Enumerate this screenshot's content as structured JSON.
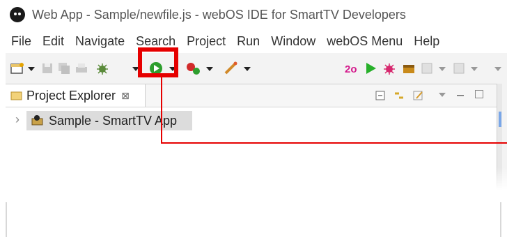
{
  "window": {
    "title": "Web App - Sample/newfile.js - webOS IDE for SmartTV Developers"
  },
  "menu": [
    "File",
    "Edit",
    "Navigate",
    "Search",
    "Project",
    "Run",
    "Window",
    "webOS Menu",
    "Help"
  ],
  "toolbar": {
    "icons": [
      "new-wizard-icon",
      "save-icon",
      "save-all-icon",
      "print-icon",
      "debug-icon",
      "run-icon",
      "external-tools-icon",
      "launch-icon",
      "webos-project-icon",
      "run-green-icon",
      "debug-bug-icon",
      "package-icon",
      "history-icon",
      "nav-icon"
    ]
  },
  "explorer": {
    "tab_label": "Project Explorer",
    "close_glyph": "⊠",
    "tree": [
      {
        "label": "Sample - SmartTV App"
      }
    ]
  },
  "colors": {
    "highlight": "#e60000",
    "run_green": "#2e9e2e",
    "selection": "#dcdcdc"
  }
}
